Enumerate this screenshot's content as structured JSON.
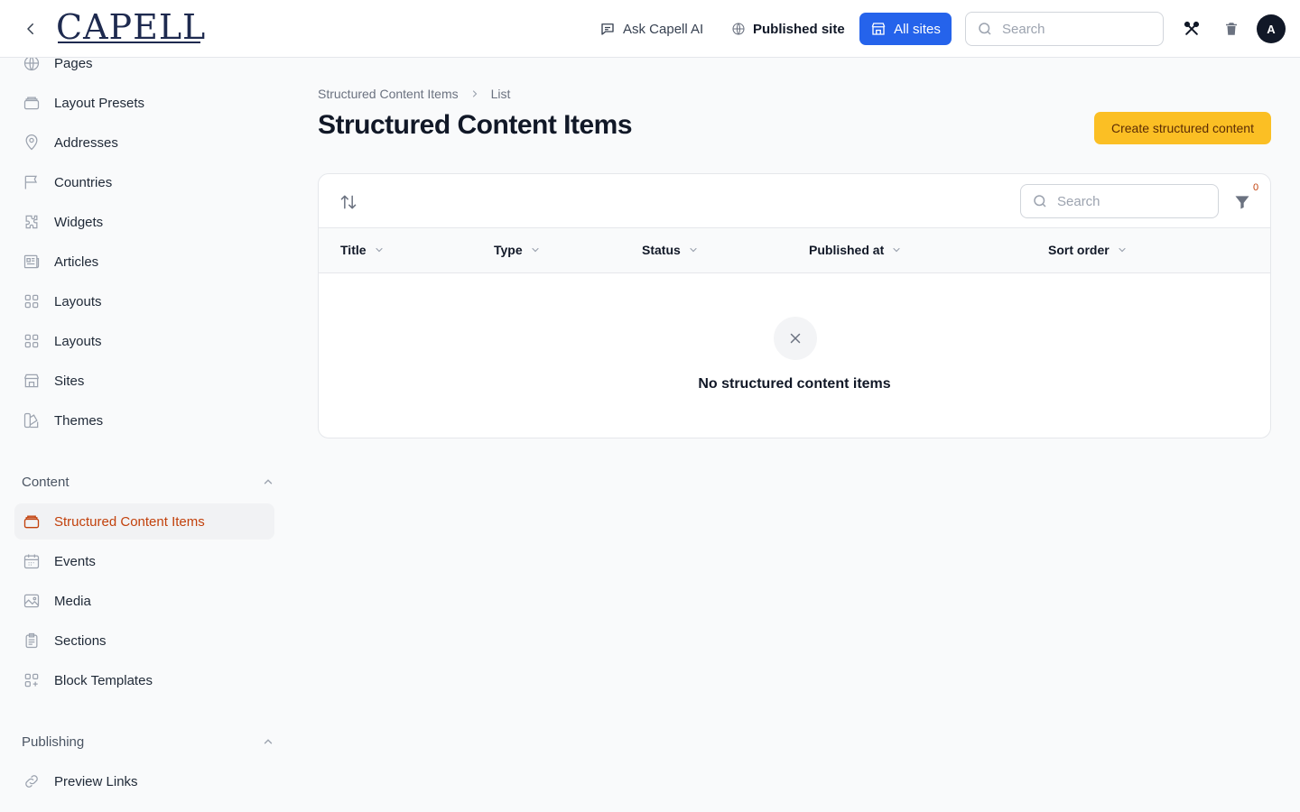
{
  "topbar": {
    "logo": "CAPELL",
    "ask_ai_label": "Ask Capell AI",
    "published_site_label": "Published site",
    "all_sites_label": "All sites",
    "search_placeholder": "Search",
    "avatar_initial": "A",
    "accent_color": "#2563eb"
  },
  "sidebar": {
    "items_top": [
      {
        "label": "Pages",
        "icon": "globe-icon"
      },
      {
        "label": "Layout Presets",
        "icon": "stack-icon"
      },
      {
        "label": "Addresses",
        "icon": "map-pin-icon"
      },
      {
        "label": "Countries",
        "icon": "flag-icon"
      },
      {
        "label": "Widgets",
        "icon": "puzzle-icon"
      },
      {
        "label": "Articles",
        "icon": "newspaper-icon"
      },
      {
        "label": "Layouts",
        "icon": "grid-icon"
      },
      {
        "label": "Layouts",
        "icon": "grid-icon"
      },
      {
        "label": "Sites",
        "icon": "building-storefront-icon"
      },
      {
        "label": "Themes",
        "icon": "swatch-icon"
      }
    ],
    "content_group": {
      "label": "Content",
      "items": [
        {
          "label": "Structured Content Items",
          "icon": "stack-icon",
          "active": true
        },
        {
          "label": "Events",
          "icon": "calendar-icon"
        },
        {
          "label": "Media",
          "icon": "photo-icon"
        },
        {
          "label": "Sections",
          "icon": "clipboard-document-icon"
        },
        {
          "label": "Block Templates",
          "icon": "squares-plus-icon"
        }
      ]
    },
    "publishing_group": {
      "label": "Publishing",
      "items": [
        {
          "label": "Preview Links",
          "icon": "link-icon"
        }
      ]
    },
    "active_color": "#c2410c"
  },
  "main": {
    "breadcrumb": [
      "Structured Content Items",
      "List"
    ],
    "title": "Structured Content Items",
    "create_button": "Create structured content",
    "create_button_color": "#fbbf24",
    "table": {
      "search_placeholder": "Search",
      "filter_count": "0",
      "columns": [
        "Title",
        "Type",
        "Status",
        "Published at",
        "Sort order"
      ],
      "empty_message": "No structured content items"
    }
  }
}
